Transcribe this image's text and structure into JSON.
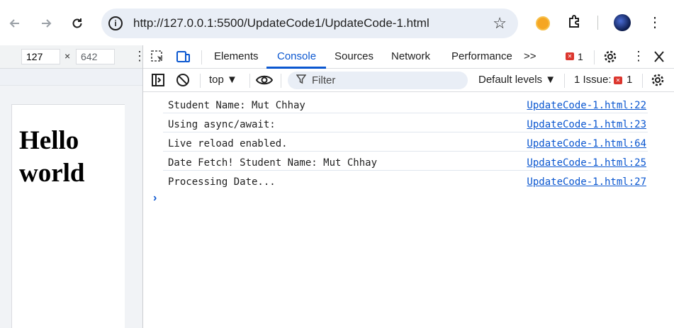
{
  "browser": {
    "url": "http://127.0.0.1:5500/UpdateCode1/UpdateCode-1.html",
    "back_icon": "arrow-left-icon",
    "forward_icon": "arrow-right-icon",
    "reload_icon": "reload-icon"
  },
  "device_toolbar": {
    "width": "127",
    "height": "642",
    "separator": "×"
  },
  "page": {
    "heading": "Hello world"
  },
  "devtools": {
    "tabs": [
      {
        "label": "Elements"
      },
      {
        "label": "Console"
      },
      {
        "label": "Sources"
      },
      {
        "label": "Network"
      },
      {
        "label": "Performance"
      }
    ],
    "more_tabs": ">>",
    "error_count": "1",
    "badge_glyph": "✕"
  },
  "console_toolbar": {
    "context": "top ▼",
    "filter_placeholder": "Filter",
    "levels": "Default levels ▼",
    "issues_label": "1 Issue:",
    "issues_count": "1"
  },
  "console": {
    "messages": [
      {
        "text": "Student Name: Mut Chhay",
        "source": "UpdateCode-1.html:22"
      },
      {
        "text": "Using async/await:",
        "source": "UpdateCode-1.html:23"
      },
      {
        "text": "Live reload enabled.",
        "source": "UpdateCode-1.html:64"
      },
      {
        "text": "Date Fetch! Student Name: Mut Chhay",
        "source": "UpdateCode-1.html:25"
      },
      {
        "text": "Processing Date...",
        "source": "UpdateCode-1.html:27"
      }
    ],
    "prompt": "›"
  },
  "colors": {
    "accent": "#0b57d0",
    "error": "#dc362e"
  }
}
